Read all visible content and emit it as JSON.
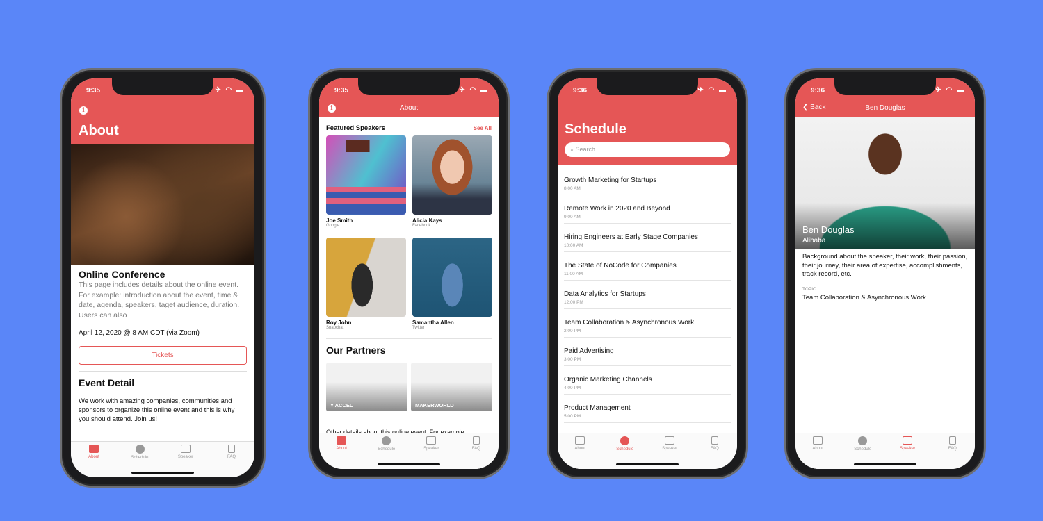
{
  "colors": {
    "background": "#5a86f8",
    "accent": "#e55656"
  },
  "tabs": [
    "About",
    "Schedule",
    "Speaker",
    "FAQ"
  ],
  "phone1": {
    "time": "9:35",
    "title": "About",
    "event_title": "Online Conference",
    "intro": "This page includes details about the online event. For example: introduction about the event, time & date, agenda, speakers, taget audience, duration. Users can also",
    "date": "April 12, 2020 @ 8 AM CDT (via Zoom)",
    "tickets": "Tickets",
    "detail_heading": "Event Detail",
    "detail_text": "We work with amazing companies, communities and sponsors to organize this online event and this is why you should attend. Join us!",
    "active_tab": "About"
  },
  "phone2": {
    "time": "9:35",
    "nav_title": "About",
    "featured": "Featured Speakers",
    "see_all": "See All",
    "speakers": [
      {
        "name": "Joe Smith",
        "company": "Google"
      },
      {
        "name": "Alicia Kays",
        "company": "Facebook"
      },
      {
        "name": "Roy John",
        "company": "Snapchat"
      },
      {
        "name": "Samantha Allen",
        "company": "Twitter"
      }
    ],
    "partners_heading": "Our Partners",
    "partners": [
      "Y ACCEL",
      "MAKERWORLD"
    ],
    "other": "Other details about this online event. For example:",
    "active_tab": "About"
  },
  "phone3": {
    "time": "9:36",
    "title": "Schedule",
    "search_placeholder": "Search",
    "sessions": [
      {
        "title": "Growth Marketing for Startups",
        "time": "8:00 AM"
      },
      {
        "title": "Remote Work in 2020 and Beyond",
        "time": "9:00 AM"
      },
      {
        "title": "Hiring Engineers at Early Stage Companies",
        "time": "10:00 AM"
      },
      {
        "title": "The State of NoCode for Companies",
        "time": "11:00 AM"
      },
      {
        "title": "Data Analytics for Startups",
        "time": "12:00 PM"
      },
      {
        "title": "Team Collaboration & Asynchronous Work",
        "time": "2:00 PM"
      },
      {
        "title": "Paid Advertising",
        "time": "3:00 PM"
      },
      {
        "title": "Organic Marketing Channels",
        "time": "4:00 PM"
      },
      {
        "title": "Product Management",
        "time": "5:00 PM"
      }
    ],
    "active_tab": "Schedule"
  },
  "phone4": {
    "time": "9:36",
    "back": "Back",
    "nav_title": "Ben Douglas",
    "name": "Ben Douglas",
    "company": "Alibaba",
    "bio": "Background about the speaker, their work, their passion, their journey, their area of expertise, accomplishments, track record, etc.",
    "topic_label": "TOPIC",
    "topic": "Team Collaboration & Asynchronous Work",
    "active_tab": "Speaker"
  }
}
